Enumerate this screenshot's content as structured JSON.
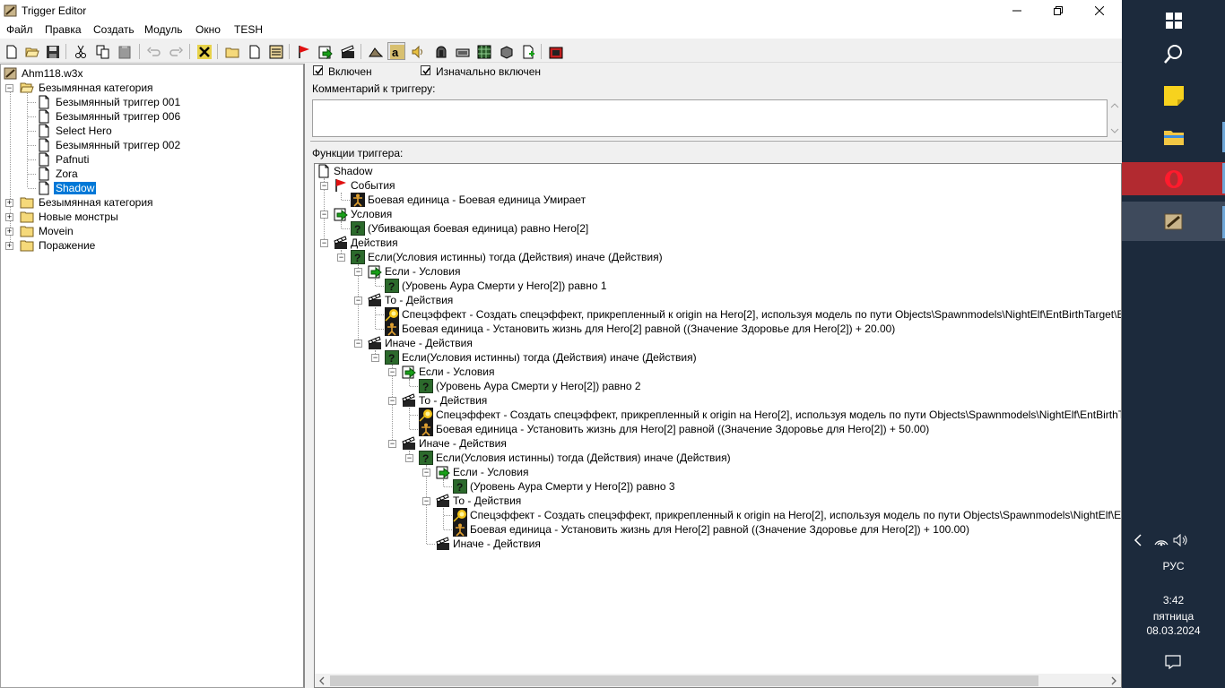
{
  "window": {
    "title": "Trigger Editor"
  },
  "menu": [
    "Файл",
    "Правка",
    "Создать",
    "Модуль",
    "Окно",
    "TESH"
  ],
  "left_tree": {
    "root": "Ahm118.w3x",
    "items": [
      {
        "label": "Безымянная категория",
        "type": "folder-open"
      },
      {
        "label": "Безымянный триггер 001",
        "type": "trigger"
      },
      {
        "label": "Безымянный триггер 006",
        "type": "trigger"
      },
      {
        "label": "Select Hero",
        "type": "trigger"
      },
      {
        "label": "Безымянный триггер 002",
        "type": "trigger"
      },
      {
        "label": "Pafnuti",
        "type": "trigger"
      },
      {
        "label": "Zora",
        "type": "trigger"
      },
      {
        "label": "Shadow",
        "type": "trigger",
        "selected": true
      },
      {
        "label": "Безымянная категория",
        "type": "folder"
      },
      {
        "label": "Новые монстры",
        "type": "folder"
      },
      {
        "label": "Movein",
        "type": "folder"
      },
      {
        "label": "Поражение",
        "type": "folder"
      }
    ]
  },
  "trigger": {
    "enabled_label": "Включен",
    "initially_enabled_label": "Изначально включен",
    "enabled": true,
    "initially_enabled": true,
    "comment_label": "Комментарий к триггеру:",
    "comment": "",
    "functions_label": "Функции триггера:"
  },
  "functions_tree": [
    {
      "label": "Shadow",
      "icon": "trigger-page-icon"
    },
    {
      "label": "События",
      "icon": "red-flag-icon"
    },
    {
      "label": "Боевая единица - Боевая единица Умирает",
      "icon": "unit-icon"
    },
    {
      "label": "Условия",
      "icon": "condition-arrow-icon"
    },
    {
      "label": "(Убивающая боевая единица) равно Hero[2]",
      "icon": "question-icon"
    },
    {
      "label": "Действия",
      "icon": "clapper-icon"
    },
    {
      "label": "Если(Условия истинны) тогда (Действия) иначе (Действия)",
      "icon": "question-icon"
    },
    {
      "label": "Если - Условия",
      "icon": "condition-arrow-icon"
    },
    {
      "label": "(Уровень Аура Смерти у Hero[2]) равно 1",
      "icon": "question-icon"
    },
    {
      "label": "То - Действия",
      "icon": "clapper-icon"
    },
    {
      "label": "Спецэффект - Создать спецэффект, прикрепленный к origin на Hero[2], используя модель по пути Objects\\Spawnmodels\\NightElf\\EntBirthTarget\\EntBirthTarget.mdl",
      "icon": "effect-icon"
    },
    {
      "label": "Боевая единица - Установить жизнь для Hero[2] равной ((Значение Здоровье для Hero[2]) + 20.00)",
      "icon": "unit-icon"
    },
    {
      "label": "Иначе - Действия",
      "icon": "clapper-icon"
    },
    {
      "label": "Если(Условия истинны) тогда (Действия) иначе (Действия)",
      "icon": "question-icon"
    },
    {
      "label": "Если - Условия",
      "icon": "condition-arrow-icon"
    },
    {
      "label": "(Уровень Аура Смерти у Hero[2]) равно 2",
      "icon": "question-icon"
    },
    {
      "label": "То - Действия",
      "icon": "clapper-icon"
    },
    {
      "label": "Спецэффект - Создать спецэффект, прикрепленный к origin на Hero[2], используя модель по пути Objects\\Spawnmodels\\NightElf\\EntBirthTarget\\EntBirthTarget.mdl",
      "icon": "effect-icon"
    },
    {
      "label": "Боевая единица - Установить жизнь для Hero[2] равной ((Значение Здоровье для Hero[2]) + 50.00)",
      "icon": "unit-icon"
    },
    {
      "label": "Иначе - Действия",
      "icon": "clapper-icon"
    },
    {
      "label": "Если(Условия истинны) тогда (Действия) иначе (Действия)",
      "icon": "question-icon"
    },
    {
      "label": "Если - Условия",
      "icon": "condition-arrow-icon"
    },
    {
      "label": "(Уровень Аура Смерти у Hero[2]) равно 3",
      "icon": "question-icon"
    },
    {
      "label": "То - Действия",
      "icon": "clapper-icon"
    },
    {
      "label": "Спецэффект - Создать спецэффект, прикрепленный к origin на Hero[2], используя модель по пути Objects\\Spawnmodels\\NightElf\\EntBirthTarget\\EntBirthTarget.mdl",
      "icon": "effect-icon"
    },
    {
      "label": "Боевая единица - Установить жизнь для Hero[2] равной ((Значение Здоровье для Hero[2]) + 100.00)",
      "icon": "unit-icon"
    },
    {
      "label": "Иначе - Действия",
      "icon": "clapper-icon"
    }
  ],
  "taskbar": {
    "language": "РУС",
    "time": "3:42",
    "day": "пятница",
    "date": "08.03.2024"
  },
  "colors": {
    "selection": "#0078d7",
    "taskbar": "#1c2a3c",
    "opera": "#b22a30"
  }
}
